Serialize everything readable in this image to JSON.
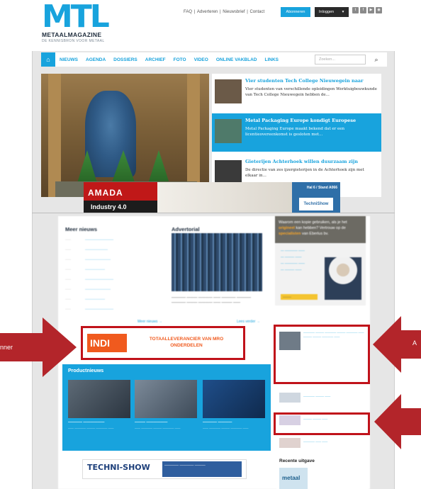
{
  "header": {
    "logo_main": "MTL",
    "logo_sub": "METAALMAGAZINE",
    "logo_tagline": "DE KENNISBRON VOOR METAAL",
    "top_links": [
      "FAQ",
      "Adverteren",
      "Nieuwsbrief",
      "Contact"
    ],
    "subscribe_label": "Abonneren",
    "login_label": "Inloggen",
    "social_icons": [
      "twitter-icon",
      "facebook-icon",
      "youtube-icon",
      "rss-icon"
    ]
  },
  "nav": {
    "home_icon": "home-icon",
    "items": [
      "NIEUWS",
      "AGENDA",
      "DOSSIERS",
      "ARCHIEF",
      "FOTO",
      "VIDEO",
      "ONLINE VAKBLAD",
      "LINKS"
    ],
    "search_placeholder": "Zoeken..."
  },
  "hero_stories": [
    {
      "title": "Vier studenten Tech College Nieuwegein naar",
      "desc": "Vier studenten van verschillende opleidingen Werktuigbouwkunde van Tech College Nieuwegein hebben de..."
    },
    {
      "title": "Metal Packaging Europe kondigt Europese",
      "desc": "Metal Packaging Europe maakt bekend dat er een licentieovereenkomst is gesloten met..."
    },
    {
      "title": "Gieterijen Achterhoek willen duurzaam zijn",
      "desc": "De directie van zes ijzergieterijen in de Achterhoek zijn met elkaar in..."
    }
  ],
  "banner": {
    "amada_name": "AMADA",
    "amada_tag": "Industry 4.0",
    "hall_text": "Hal 6 / Stand A066",
    "show_name": "TechniShow"
  },
  "lower": {
    "meer_nieuws_heading": "Meer nieuws",
    "advertorial_heading": "Advertorial",
    "meer_nieuws_link": "Meer nieuws →",
    "lees_verder": "Lees verder →",
    "productnieuws_heading": "Productnieuws",
    "ad_headline_1": "Waarom een kopie gebruiken, als je het",
    "ad_headline_2": "origineel",
    "ad_headline_3": "kan hebben? Vertrouw op de",
    "ad_headline_4": "specialisten",
    "ad_headline_5": "van Eberlus bv.",
    "indi_logo": "INDI",
    "indi_text": "TOTAALLEVERANCIER VAN MRO ONDERDELEN",
    "techni_show": "TECHNI-SHOW",
    "recente_uitgave": "Recente uitgave",
    "magazine_name": "metaal"
  },
  "annotations": {
    "left_label": "nner",
    "right_label": "A"
  },
  "colors": {
    "brand_blue": "#18a3dd",
    "highlight_red": "#c0121a",
    "arrow_red": "#b3252a"
  }
}
